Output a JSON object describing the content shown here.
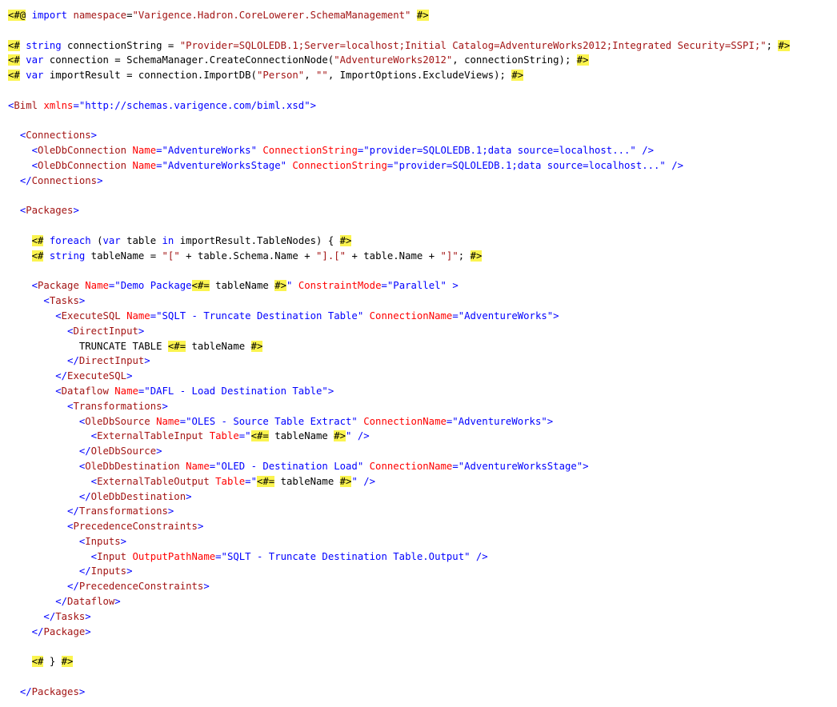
{
  "editor": {
    "lines": [
      [
        [
          "hl",
          "<#@"
        ],
        [
          "p",
          " "
        ],
        [
          "kw",
          "import"
        ],
        [
          "p",
          " "
        ],
        [
          "el",
          "namespace"
        ],
        [
          "p",
          "="
        ],
        [
          "str",
          "\"Varigence.Hadron.CoreLowerer.SchemaManagement\""
        ],
        [
          "p",
          " "
        ],
        [
          "hl",
          "#>"
        ]
      ],
      [],
      [
        [
          "hl",
          "<#"
        ],
        [
          "p",
          " "
        ],
        [
          "kw",
          "string"
        ],
        [
          "p",
          " connectionString = "
        ],
        [
          "str",
          "\"Provider=SQLOLEDB.1;Server=localhost;Initial Catalog=AdventureWorks2012;Integrated Security=SSPI;\""
        ],
        [
          "p",
          "; "
        ],
        [
          "hl",
          "#>"
        ]
      ],
      [
        [
          "hl",
          "<#"
        ],
        [
          "p",
          " "
        ],
        [
          "kw",
          "var"
        ],
        [
          "p",
          " connection = SchemaManager.CreateConnectionNode("
        ],
        [
          "str",
          "\"AdventureWorks2012\""
        ],
        [
          "p",
          ", connectionString); "
        ],
        [
          "hl",
          "#>"
        ]
      ],
      [
        [
          "hl",
          "<#"
        ],
        [
          "p",
          " "
        ],
        [
          "kw",
          "var"
        ],
        [
          "p",
          " importResult = connection.ImportDB("
        ],
        [
          "str",
          "\"Person\""
        ],
        [
          "p",
          ", "
        ],
        [
          "str",
          "\"\""
        ],
        [
          "p",
          ", ImportOptions.ExcludeViews); "
        ],
        [
          "hl",
          "#>"
        ]
      ],
      [],
      [
        [
          "av",
          "<"
        ],
        [
          "el",
          "Biml"
        ],
        [
          "p",
          " "
        ],
        [
          "at",
          "xmlns"
        ],
        [
          "av",
          "=\"http://schemas.varigence.com/biml.xsd\">"
        ]
      ],
      [],
      [
        [
          "p",
          "  "
        ],
        [
          "av",
          "<"
        ],
        [
          "el",
          "Connections"
        ],
        [
          "av",
          ">"
        ]
      ],
      [
        [
          "p",
          "    "
        ],
        [
          "av",
          "<"
        ],
        [
          "el",
          "OleDbConnection"
        ],
        [
          "p",
          " "
        ],
        [
          "at",
          "Name"
        ],
        [
          "av",
          "=\"AdventureWorks\""
        ],
        [
          "p",
          " "
        ],
        [
          "at",
          "ConnectionString"
        ],
        [
          "av",
          "=\"provider=SQLOLEDB.1;data source=localhost...\" />"
        ]
      ],
      [
        [
          "p",
          "    "
        ],
        [
          "av",
          "<"
        ],
        [
          "el",
          "OleDbConnection"
        ],
        [
          "p",
          " "
        ],
        [
          "at",
          "Name"
        ],
        [
          "av",
          "=\"AdventureWorksStage\""
        ],
        [
          "p",
          " "
        ],
        [
          "at",
          "ConnectionString"
        ],
        [
          "av",
          "=\"provider=SQLOLEDB.1;data source=localhost...\" />"
        ]
      ],
      [
        [
          "p",
          "  "
        ],
        [
          "av",
          "</"
        ],
        [
          "el",
          "Connections"
        ],
        [
          "av",
          ">"
        ]
      ],
      [],
      [
        [
          "p",
          "  "
        ],
        [
          "av",
          "<"
        ],
        [
          "el",
          "Packages"
        ],
        [
          "av",
          ">"
        ]
      ],
      [],
      [
        [
          "p",
          "    "
        ],
        [
          "hl",
          "<#"
        ],
        [
          "p",
          " "
        ],
        [
          "kw",
          "foreach"
        ],
        [
          "p",
          " ("
        ],
        [
          "kw",
          "var"
        ],
        [
          "p",
          " table "
        ],
        [
          "kw",
          "in"
        ],
        [
          "p",
          " importResult.TableNodes) { "
        ],
        [
          "hl",
          "#>"
        ]
      ],
      [
        [
          "p",
          "    "
        ],
        [
          "hl",
          "<#"
        ],
        [
          "p",
          " "
        ],
        [
          "kw",
          "string"
        ],
        [
          "p",
          " tableName = "
        ],
        [
          "str",
          "\"[\""
        ],
        [
          "p",
          " + table.Schema.Name + "
        ],
        [
          "str",
          "\"].[\""
        ],
        [
          "p",
          " + table.Name + "
        ],
        [
          "str",
          "\"]\""
        ],
        [
          "p",
          "; "
        ],
        [
          "hl",
          "#>"
        ]
      ],
      [],
      [
        [
          "p",
          "    "
        ],
        [
          "av",
          "<"
        ],
        [
          "el",
          "Package"
        ],
        [
          "p",
          " "
        ],
        [
          "at",
          "Name"
        ],
        [
          "av",
          "=\"Demo Package"
        ],
        [
          "hl",
          "<#="
        ],
        [
          "p",
          " tableName "
        ],
        [
          "hl",
          "#>"
        ],
        [
          "av",
          "\""
        ],
        [
          "p",
          " "
        ],
        [
          "at",
          "ConstraintMode"
        ],
        [
          "av",
          "=\"Parallel\" >"
        ]
      ],
      [
        [
          "p",
          "      "
        ],
        [
          "av",
          "<"
        ],
        [
          "el",
          "Tasks"
        ],
        [
          "av",
          ">"
        ]
      ],
      [
        [
          "p",
          "        "
        ],
        [
          "av",
          "<"
        ],
        [
          "el",
          "ExecuteSQL"
        ],
        [
          "p",
          " "
        ],
        [
          "at",
          "Name"
        ],
        [
          "av",
          "=\"SQLT - Truncate Destination Table\""
        ],
        [
          "p",
          " "
        ],
        [
          "at",
          "ConnectionName"
        ],
        [
          "av",
          "=\"AdventureWorks\">"
        ]
      ],
      [
        [
          "p",
          "          "
        ],
        [
          "av",
          "<"
        ],
        [
          "el",
          "DirectInput"
        ],
        [
          "av",
          ">"
        ]
      ],
      [
        [
          "p",
          "            TRUNCATE TABLE "
        ],
        [
          "hl",
          "<#="
        ],
        [
          "p",
          " tableName "
        ],
        [
          "hl",
          "#>"
        ]
      ],
      [
        [
          "p",
          "          "
        ],
        [
          "av",
          "</"
        ],
        [
          "el",
          "DirectInput"
        ],
        [
          "av",
          ">"
        ]
      ],
      [
        [
          "p",
          "        "
        ],
        [
          "av",
          "</"
        ],
        [
          "el",
          "ExecuteSQL"
        ],
        [
          "av",
          ">"
        ]
      ],
      [
        [
          "p",
          "        "
        ],
        [
          "av",
          "<"
        ],
        [
          "el",
          "Dataflow"
        ],
        [
          "p",
          " "
        ],
        [
          "at",
          "Name"
        ],
        [
          "av",
          "=\"DAFL - Load Destination Table\">"
        ]
      ],
      [
        [
          "p",
          "          "
        ],
        [
          "av",
          "<"
        ],
        [
          "el",
          "Transformations"
        ],
        [
          "av",
          ">"
        ]
      ],
      [
        [
          "p",
          "            "
        ],
        [
          "av",
          "<"
        ],
        [
          "el",
          "OleDbSource"
        ],
        [
          "p",
          " "
        ],
        [
          "at",
          "Name"
        ],
        [
          "av",
          "=\"OLES - Source Table Extract\""
        ],
        [
          "p",
          " "
        ],
        [
          "at",
          "ConnectionName"
        ],
        [
          "av",
          "=\"AdventureWorks\">"
        ]
      ],
      [
        [
          "p",
          "              "
        ],
        [
          "av",
          "<"
        ],
        [
          "el",
          "ExternalTableInput"
        ],
        [
          "p",
          " "
        ],
        [
          "at",
          "Table"
        ],
        [
          "av",
          "=\""
        ],
        [
          "hl",
          "<#="
        ],
        [
          "p",
          " tableName "
        ],
        [
          "hl",
          "#>"
        ],
        [
          "av",
          "\" />"
        ]
      ],
      [
        [
          "p",
          "            "
        ],
        [
          "av",
          "</"
        ],
        [
          "el",
          "OleDbSource"
        ],
        [
          "av",
          ">"
        ]
      ],
      [
        [
          "p",
          "            "
        ],
        [
          "av",
          "<"
        ],
        [
          "el",
          "OleDbDestination"
        ],
        [
          "p",
          " "
        ],
        [
          "at",
          "Name"
        ],
        [
          "av",
          "=\"OLED - Destination Load\""
        ],
        [
          "p",
          " "
        ],
        [
          "at",
          "ConnectionName"
        ],
        [
          "av",
          "=\"AdventureWorksStage\">"
        ]
      ],
      [
        [
          "p",
          "              "
        ],
        [
          "av",
          "<"
        ],
        [
          "el",
          "ExternalTableOutput"
        ],
        [
          "p",
          " "
        ],
        [
          "at",
          "Table"
        ],
        [
          "av",
          "=\""
        ],
        [
          "hl",
          "<#="
        ],
        [
          "p",
          " tableName "
        ],
        [
          "hl",
          "#>"
        ],
        [
          "av",
          "\" />"
        ]
      ],
      [
        [
          "p",
          "            "
        ],
        [
          "av",
          "</"
        ],
        [
          "el",
          "OleDbDestination"
        ],
        [
          "av",
          ">"
        ]
      ],
      [
        [
          "p",
          "          "
        ],
        [
          "av",
          "</"
        ],
        [
          "el",
          "Transformations"
        ],
        [
          "av",
          ">"
        ]
      ],
      [
        [
          "p",
          "          "
        ],
        [
          "av",
          "<"
        ],
        [
          "el",
          "PrecedenceConstraints"
        ],
        [
          "av",
          ">"
        ]
      ],
      [
        [
          "p",
          "            "
        ],
        [
          "av",
          "<"
        ],
        [
          "el",
          "Inputs"
        ],
        [
          "av",
          ">"
        ]
      ],
      [
        [
          "p",
          "              "
        ],
        [
          "av",
          "<"
        ],
        [
          "el",
          "Input"
        ],
        [
          "p",
          " "
        ],
        [
          "at",
          "OutputPathName"
        ],
        [
          "av",
          "=\"SQLT - Truncate Destination Table.Output\" />"
        ]
      ],
      [
        [
          "p",
          "            "
        ],
        [
          "av",
          "</"
        ],
        [
          "el",
          "Inputs"
        ],
        [
          "av",
          ">"
        ]
      ],
      [
        [
          "p",
          "          "
        ],
        [
          "av",
          "</"
        ],
        [
          "el",
          "PrecedenceConstraints"
        ],
        [
          "av",
          ">"
        ]
      ],
      [
        [
          "p",
          "        "
        ],
        [
          "av",
          "</"
        ],
        [
          "el",
          "Dataflow"
        ],
        [
          "av",
          ">"
        ]
      ],
      [
        [
          "p",
          "      "
        ],
        [
          "av",
          "</"
        ],
        [
          "el",
          "Tasks"
        ],
        [
          "av",
          ">"
        ]
      ],
      [
        [
          "p",
          "    "
        ],
        [
          "av",
          "</"
        ],
        [
          "el",
          "Package"
        ],
        [
          "av",
          ">"
        ]
      ],
      [],
      [
        [
          "p",
          "    "
        ],
        [
          "hl",
          "<#"
        ],
        [
          "p",
          " } "
        ],
        [
          "hl",
          "#>"
        ]
      ],
      [],
      [
        [
          "p",
          "  "
        ],
        [
          "av",
          "</"
        ],
        [
          "el",
          "Packages"
        ],
        [
          "av",
          ">"
        ]
      ]
    ]
  }
}
